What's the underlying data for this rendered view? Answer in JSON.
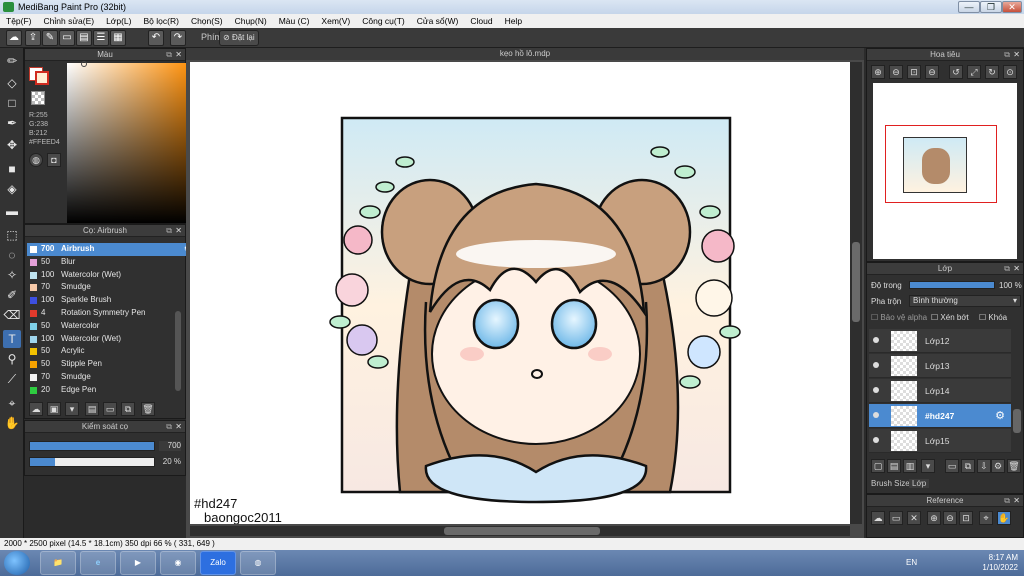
{
  "window": {
    "title": "MediBang Paint Pro (32bit)",
    "minimize": "—",
    "maximize": "❐",
    "close": "✕"
  },
  "menu": [
    "Tệp(F)",
    "Chỉnh sửa(E)",
    "Lớp(L)",
    "Bộ lọc(R)",
    "Chọn(S)",
    "Chụp(N)",
    "Màu (C)",
    "Xem(V)",
    "Công cụ(T)",
    "Cửa sổ(W)",
    "Cloud",
    "Help"
  ],
  "toolbar": {
    "key_label": "Phím",
    "reset_label": "Đặt lại"
  },
  "color_panel": {
    "title": "Màu",
    "r": "R:255",
    "g": "G:238",
    "b": "B:212",
    "hex": "#FFEED4",
    "foreground": "#ffeed4"
  },
  "brush_panel": {
    "title": "Cọ: Airbrush",
    "brushes": [
      {
        "size": "700",
        "name": "Airbrush",
        "color": "#ffffff",
        "selected": true
      },
      {
        "size": "50",
        "name": "Blur",
        "color": "#e3a0d8"
      },
      {
        "size": "100",
        "name": "Watercolor (Wet)",
        "color": "#bfe3f0"
      },
      {
        "size": "70",
        "name": "Smudge",
        "color": "#f7c9a8"
      },
      {
        "size": "100",
        "name": "Sparkle Brush",
        "color": "#3d4fe0"
      },
      {
        "size": "4",
        "name": "Rotation Symmetry Pen",
        "color": "#e23a2c"
      },
      {
        "size": "50",
        "name": "Watercolor",
        "color": "#7fd0e8"
      },
      {
        "size": "100",
        "name": "Watercolor (Wet)",
        "color": "#9fd6ee"
      },
      {
        "size": "50",
        "name": "Acrylic",
        "color": "#f2c200"
      },
      {
        "size": "50",
        "name": "Stipple Pen",
        "color": "#f6a200"
      },
      {
        "size": "70",
        "name": "Smudge",
        "color": "#f3f3f3"
      },
      {
        "size": "20",
        "name": "Edge Pen",
        "color": "#2ecc40"
      }
    ]
  },
  "brush_control": {
    "title": "Kiểm soát cọ",
    "size_value": "700",
    "opacity_value": "20 %",
    "size_fraction": 1.0,
    "opacity_fraction": 0.2
  },
  "canvas": {
    "doc_title": "kẹo hồ lô.mdp",
    "signature_1": "#hd247",
    "signature_2": "baongoc2011"
  },
  "navigator": {
    "title": "Hoa tiêu"
  },
  "layer_panel": {
    "title": "Lớp",
    "opacity_label": "Độ trong",
    "opacity_value": "100 %",
    "blend_label": "Pha trộn",
    "blend_value": "Bình thường",
    "protect_alpha": "Bảo vệ alpha",
    "clipping": "Xén bớt",
    "lock": "Khóa",
    "layers": [
      {
        "name": "Lớp12",
        "selected": false
      },
      {
        "name": "Lớp13",
        "selected": false
      },
      {
        "name": "Lớp14",
        "selected": false
      },
      {
        "name": "#hd247",
        "selected": true
      },
      {
        "name": "Lớp15",
        "selected": false
      }
    ],
    "tab_brush_size": "Brush Size",
    "tab_layer": "Lớp"
  },
  "reference": {
    "title": "Reference"
  },
  "status": {
    "text": "2000 * 2500 pixel  (14.5 * 18.1cm)  350 dpi  66 %  ( 331, 649 )"
  },
  "taskbar": {
    "lang": "EN",
    "time": "8:17 AM",
    "date": "1/10/2022",
    "apps": [
      "📁",
      "e",
      "▶",
      "◉",
      "Zalo",
      "◍"
    ]
  },
  "colors": {
    "accent": "#4b8ad0",
    "panel": "#303030",
    "canvas_bg": "#494949"
  }
}
